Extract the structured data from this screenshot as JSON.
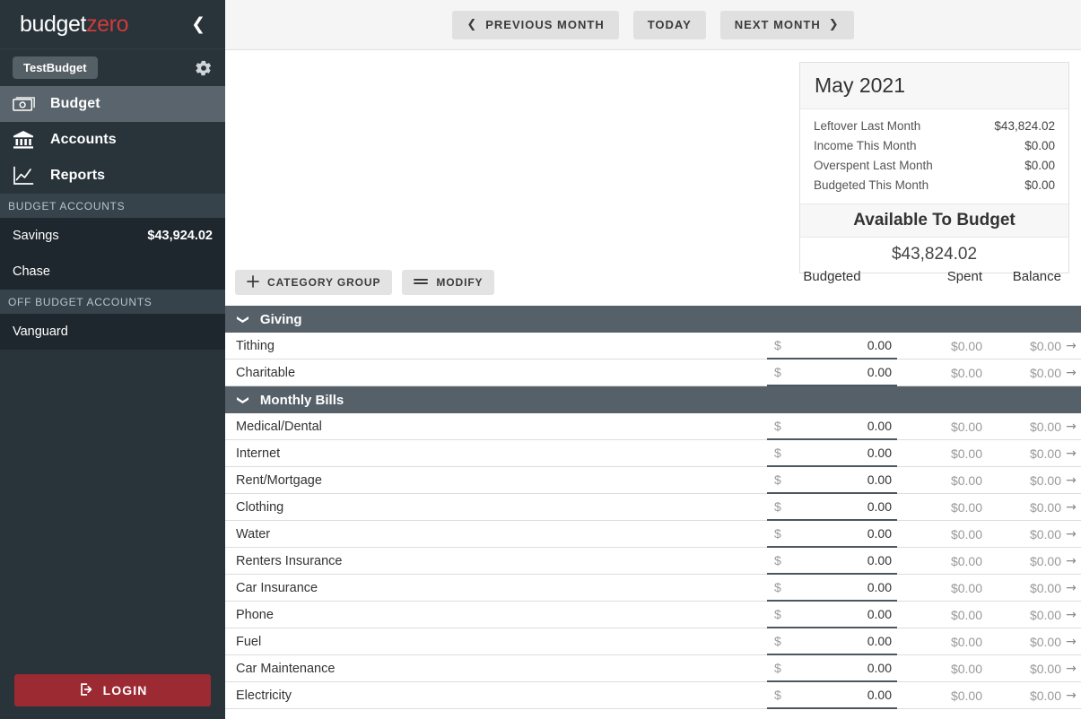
{
  "sidebar": {
    "logo": {
      "part_a": "budget",
      "part_b": "zero"
    },
    "collapse_icon": "chevron-left-icon",
    "budget_name": "TestBudget",
    "gear_icon": "gear-icon",
    "nav": [
      {
        "label": "Budget",
        "icon": "money-icon",
        "active": true
      },
      {
        "label": "Accounts",
        "icon": "bank-icon",
        "active": false
      },
      {
        "label": "Reports",
        "icon": "chart-line-icon",
        "active": false
      }
    ],
    "budget_accounts_header": "BUDGET ACCOUNTS",
    "budget_accounts": [
      {
        "name": "Savings",
        "balance": "$43,924.02"
      },
      {
        "name": "Chase",
        "balance": ""
      }
    ],
    "off_budget_accounts_header": "OFF BUDGET ACCOUNTS",
    "off_budget_accounts": [
      {
        "name": "Vanguard",
        "balance": ""
      }
    ],
    "login_label": "LOGIN",
    "login_icon": "login-icon",
    "login_color": "#9c2a33"
  },
  "topbar": {
    "previous_month": "PREVIOUS MONTH",
    "today": "TODAY",
    "next_month": "NEXT MONTH",
    "prev_icon": "chevron-left-icon",
    "next_icon": "chevron-right-icon"
  },
  "summary": {
    "title": "May 2021",
    "rows": [
      {
        "label": "Leftover Last Month",
        "value": "$43,824.02"
      },
      {
        "label": "Income This Month",
        "value": "$0.00"
      },
      {
        "label": "Overspent Last Month",
        "value": "$0.00"
      },
      {
        "label": "Budgeted This Month",
        "value": "$0.00"
      }
    ],
    "available_label": "Available To Budget",
    "available_value": "$43,824.02"
  },
  "actions": {
    "category_group": "CATEGORY GROUP",
    "category_group_icon": "plus-icon",
    "modify": "MODIFY",
    "modify_icon": "menu-lines-icon"
  },
  "columns": {
    "budgeted": "Budgeted",
    "spent": "Spent",
    "balance": "Balance"
  },
  "groups": [
    {
      "name": "Giving",
      "chevron": "chevron-down-icon",
      "categories": [
        {
          "name": "Tithing",
          "currency": "$",
          "budgeted": "0.00",
          "spent": "$0.00",
          "balance": "$0.00",
          "arrow": "arrow-right-icon"
        },
        {
          "name": "Charitable",
          "currency": "$",
          "budgeted": "0.00",
          "spent": "$0.00",
          "balance": "$0.00",
          "arrow": "arrow-right-icon"
        }
      ]
    },
    {
      "name": "Monthly Bills",
      "chevron": "chevron-down-icon",
      "categories": [
        {
          "name": "Medical/Dental",
          "currency": "$",
          "budgeted": "0.00",
          "spent": "$0.00",
          "balance": "$0.00",
          "arrow": "arrow-right-icon"
        },
        {
          "name": "Internet",
          "currency": "$",
          "budgeted": "0.00",
          "spent": "$0.00",
          "balance": "$0.00",
          "arrow": "arrow-right-icon"
        },
        {
          "name": "Rent/Mortgage",
          "currency": "$",
          "budgeted": "0.00",
          "spent": "$0.00",
          "balance": "$0.00",
          "arrow": "arrow-right-icon"
        },
        {
          "name": "Clothing",
          "currency": "$",
          "budgeted": "0.00",
          "spent": "$0.00",
          "balance": "$0.00",
          "arrow": "arrow-right-icon"
        },
        {
          "name": "Water",
          "currency": "$",
          "budgeted": "0.00",
          "spent": "$0.00",
          "balance": "$0.00",
          "arrow": "arrow-right-icon"
        },
        {
          "name": "Renters Insurance",
          "currency": "$",
          "budgeted": "0.00",
          "spent": "$0.00",
          "balance": "$0.00",
          "arrow": "arrow-right-icon"
        },
        {
          "name": "Car Insurance",
          "currency": "$",
          "budgeted": "0.00",
          "spent": "$0.00",
          "balance": "$0.00",
          "arrow": "arrow-right-icon"
        },
        {
          "name": "Phone",
          "currency": "$",
          "budgeted": "0.00",
          "spent": "$0.00",
          "balance": "$0.00",
          "arrow": "arrow-right-icon"
        },
        {
          "name": "Fuel",
          "currency": "$",
          "budgeted": "0.00",
          "spent": "$0.00",
          "balance": "$0.00",
          "arrow": "arrow-right-icon"
        },
        {
          "name": "Car Maintenance",
          "currency": "$",
          "budgeted": "0.00",
          "spent": "$0.00",
          "balance": "$0.00",
          "arrow": "arrow-right-icon"
        },
        {
          "name": "Electricity",
          "currency": "$",
          "budgeted": "0.00",
          "spent": "$0.00",
          "balance": "$0.00",
          "arrow": "arrow-right-icon"
        }
      ]
    }
  ]
}
